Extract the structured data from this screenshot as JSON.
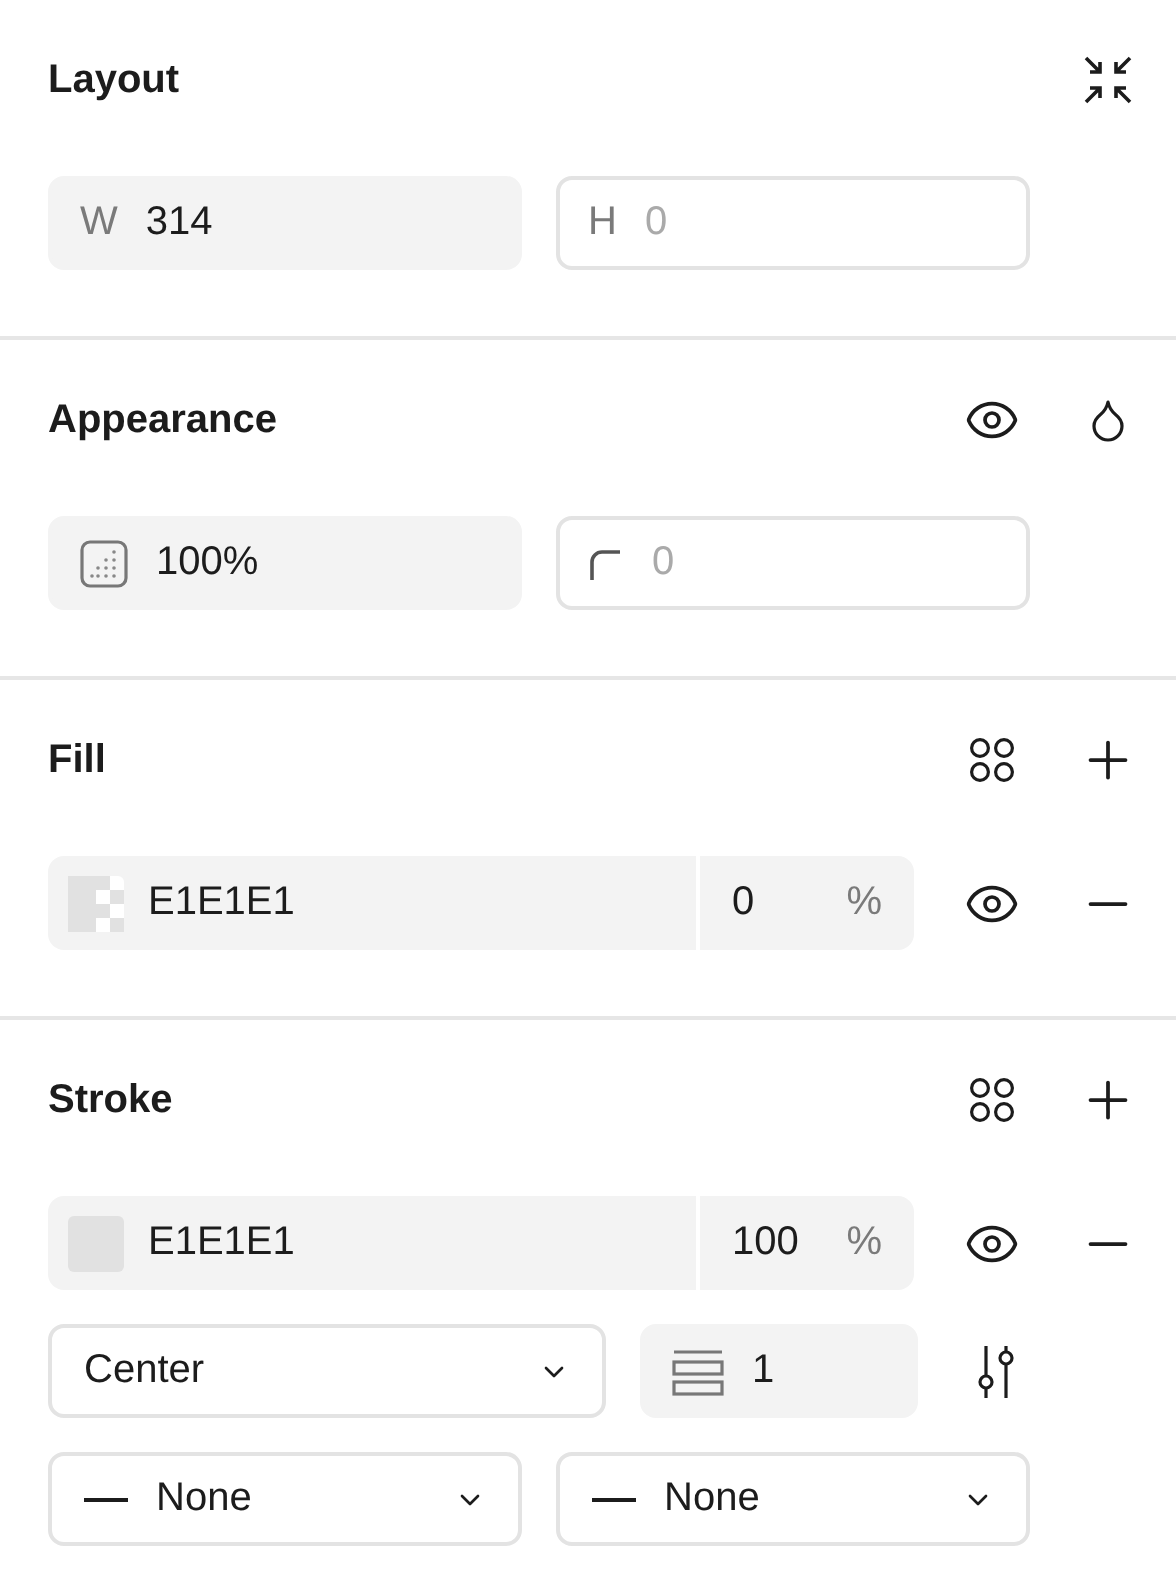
{
  "layout": {
    "title": "Layout",
    "width": {
      "label": "W",
      "value": "314"
    },
    "height": {
      "label": "H",
      "placeholder": "0"
    }
  },
  "appearance": {
    "title": "Appearance",
    "opacity": {
      "value": "100%"
    },
    "radius": {
      "placeholder": "0"
    }
  },
  "fill": {
    "title": "Fill",
    "hex": "E1E1E1",
    "opacity": "0",
    "unit": "%",
    "visible": true
  },
  "stroke": {
    "title": "Stroke",
    "hex": "E1E1E1",
    "opacity": "100",
    "unit": "%",
    "visible": true,
    "position": "Center",
    "weight": "1",
    "caps": [
      {
        "value": "None"
      },
      {
        "value": "None"
      }
    ]
  }
}
